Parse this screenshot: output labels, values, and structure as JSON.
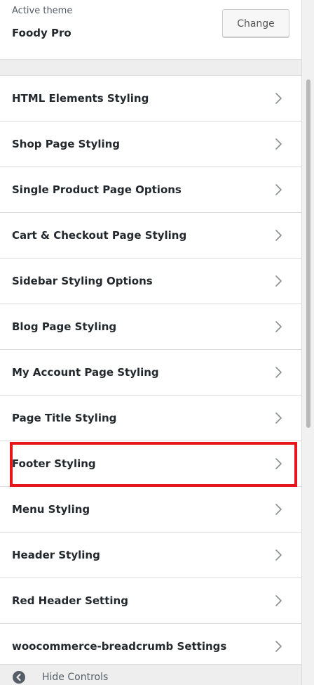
{
  "header": {
    "active_label": "Active theme",
    "theme_name": "Foody Pro",
    "change_label": "Change"
  },
  "sections": [
    {
      "label": "HTML Elements Styling",
      "name": "section-html-elements-styling"
    },
    {
      "label": "Shop Page Styling",
      "name": "section-shop-page-styling"
    },
    {
      "label": "Single Product Page Options",
      "name": "section-single-product-page-options"
    },
    {
      "label": "Cart & Checkout Page Styling",
      "name": "section-cart-checkout-page-styling"
    },
    {
      "label": "Sidebar Styling Options",
      "name": "section-sidebar-styling-options"
    },
    {
      "label": "Blog Page Styling",
      "name": "section-blog-page-styling"
    },
    {
      "label": "My Account Page Styling",
      "name": "section-my-account-page-styling"
    },
    {
      "label": "Page Title Styling",
      "name": "section-page-title-styling"
    },
    {
      "label": "Footer Styling",
      "name": "section-footer-styling"
    },
    {
      "label": "Menu Styling",
      "name": "section-menu-styling"
    },
    {
      "label": "Header Styling",
      "name": "section-header-styling"
    },
    {
      "label": "Red Header Setting",
      "name": "section-red-header-setting"
    },
    {
      "label": "woocommerce-breadcrumb Settings",
      "name": "section-woocommerce-breadcrumb-settings"
    }
  ],
  "highlighted_section": "Footer Styling",
  "colors": {
    "highlight": "#e8141b",
    "text": "#23282d",
    "muted": "#555d66"
  },
  "icons": {
    "row_arrow": "chevron-right-icon",
    "hide_controls": "collapse-circle-icon"
  },
  "footer": {
    "hide_controls_label": "Hide Controls"
  }
}
